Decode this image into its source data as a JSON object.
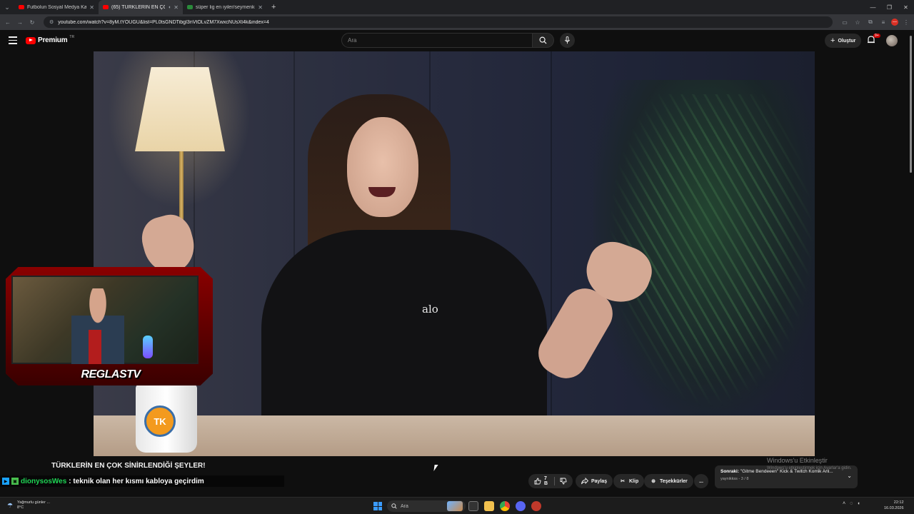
{
  "browser": {
    "tabs": [
      {
        "title": "Futbolun Sosyal Medya Kavgal...",
        "active": false
      },
      {
        "title": "(65) TÜRKLERİN EN ÇOK SİN...",
        "active": true
      },
      {
        "title": "süper lig en iyiler/seymenkiran...",
        "active": false
      }
    ],
    "url": "youtube.com/watch?v=8yM.tYOUGU&list=PL0tsGNDTibgI3nVtOLvZM7XwxcNUsXt4k&index=4"
  },
  "youtube": {
    "brand": "Premium",
    "brand_sup": "TR",
    "search_placeholder": "Ara",
    "create_label": "Oluştur",
    "notif_count": "9+"
  },
  "video": {
    "shirt_text": "alo",
    "mug_text": "TK",
    "overlay_title": "REGLASTV"
  },
  "below": {
    "title": "TÜRKLERİN EN ÇOK SİNİRLENDİĞİ ŞEYLER!",
    "chat_user": "dionysosWes",
    "chat_message": ": teknik olan her kısmı kabloya geçirdim",
    "likes": "7 B",
    "share_label": "Paylaş",
    "clip_label": "Klip",
    "thanks_label": "Teşekkürler",
    "more_label": "..."
  },
  "next_up": {
    "prefix": "Sonraki:",
    "title": "\"Gitme Bendeeen\" Kick & Twitch Komik Anl...",
    "meta": "yaynikkss - 3 / 8"
  },
  "watermark": {
    "line1": "Windows'u Etkinleştir",
    "line2": "Windows'u etkinleştirmek için Ayarlar'a gidin."
  },
  "taskbar": {
    "weather_line1": "Yağmurlu günler ...",
    "weather_line2": "8°C",
    "search_placeholder": "Ara",
    "time": "22:12",
    "date": "16.03.2026"
  },
  "colors": {
    "yt_red": "#ff0000",
    "chat_user": "#1fd655",
    "bg": "#0f0f0f"
  }
}
